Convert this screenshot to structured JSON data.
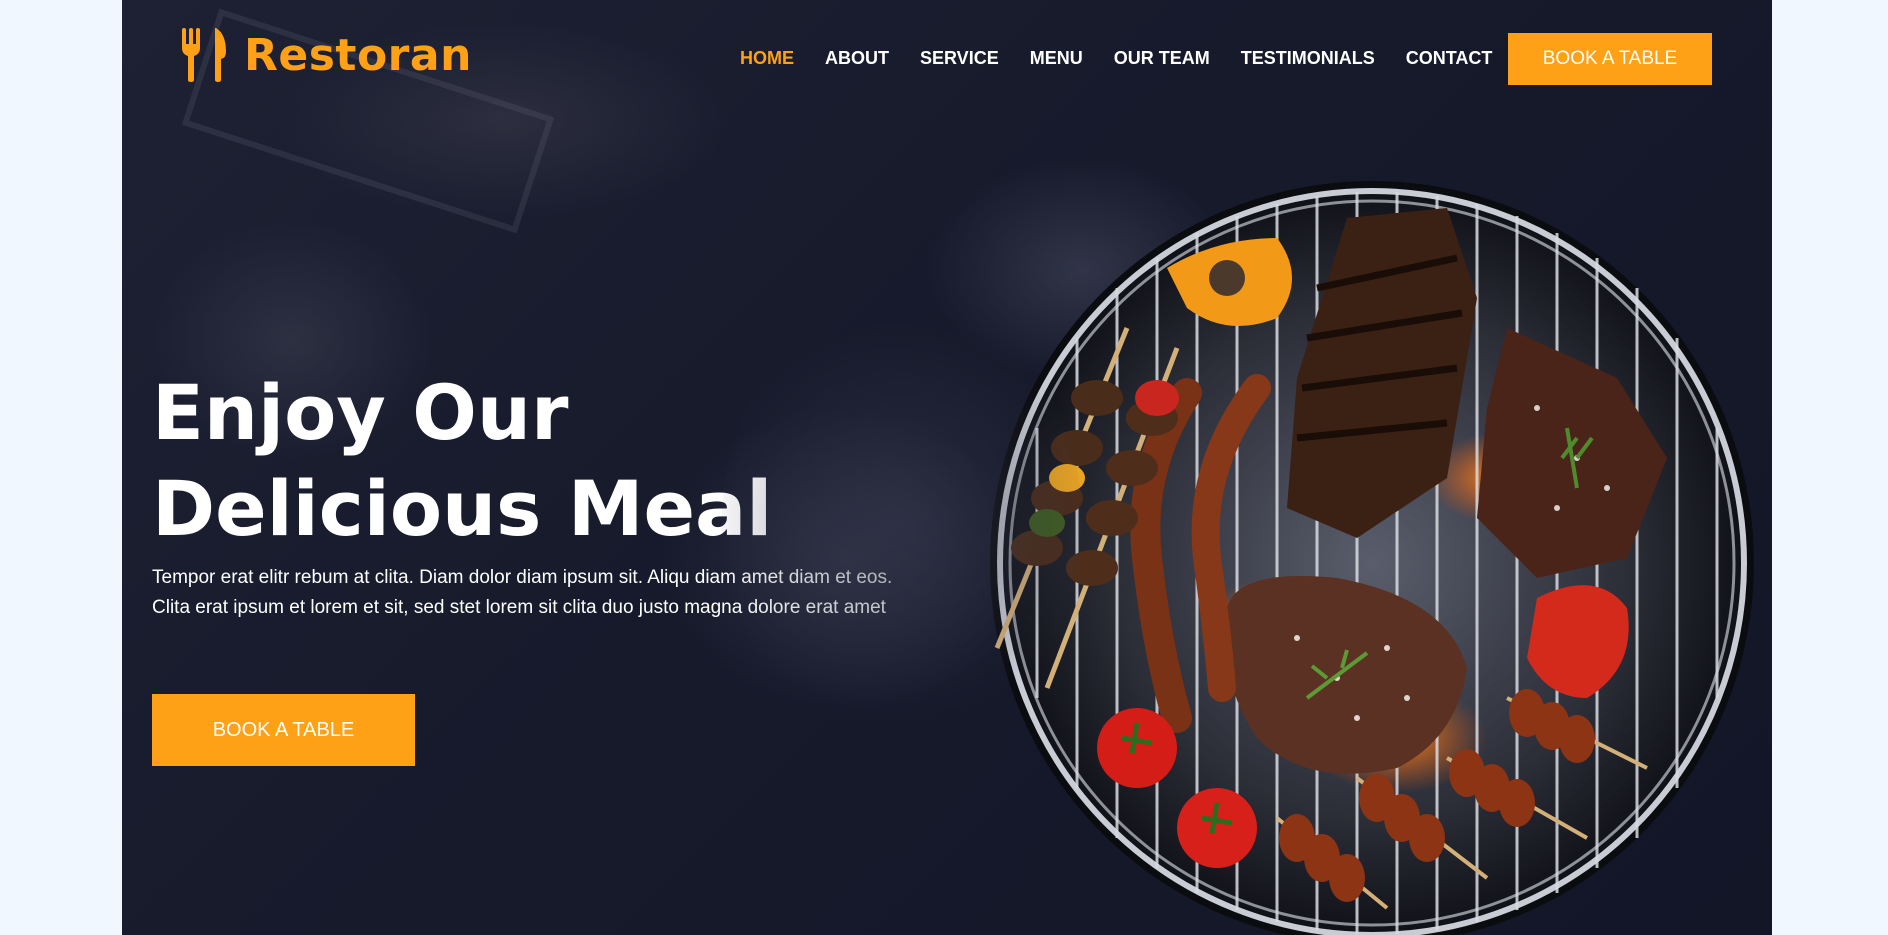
{
  "brand": {
    "name": "Restoran",
    "icon": "utensils-icon",
    "color": "#fea116"
  },
  "nav": {
    "items": [
      {
        "label": "HOME",
        "active": true
      },
      {
        "label": "ABOUT",
        "active": false
      },
      {
        "label": "SERVICE",
        "active": false
      },
      {
        "label": "MENU",
        "active": false
      },
      {
        "label": "OUR TEAM",
        "active": false
      },
      {
        "label": "TESTIMONIALS",
        "active": false
      },
      {
        "label": "CONTACT",
        "active": false
      }
    ],
    "cta_label": "BOOK A TABLE"
  },
  "hero": {
    "title_line1": "Enjoy Our",
    "title_line2": "Delicious Meal",
    "text": "Tempor erat elitr rebum at clita. Diam dolor diam ipsum sit. Aliqu diam amet diam et eos. Clita erat ipsum et lorem et sit, sed stet lorem sit clita duo justo magna dolore erat amet",
    "cta_label": "BOOK A TABLE",
    "image": "bbq-grill-image"
  },
  "colors": {
    "accent": "#fea116",
    "dark": "#0f172b",
    "page_bg": "#f1f7ff"
  }
}
